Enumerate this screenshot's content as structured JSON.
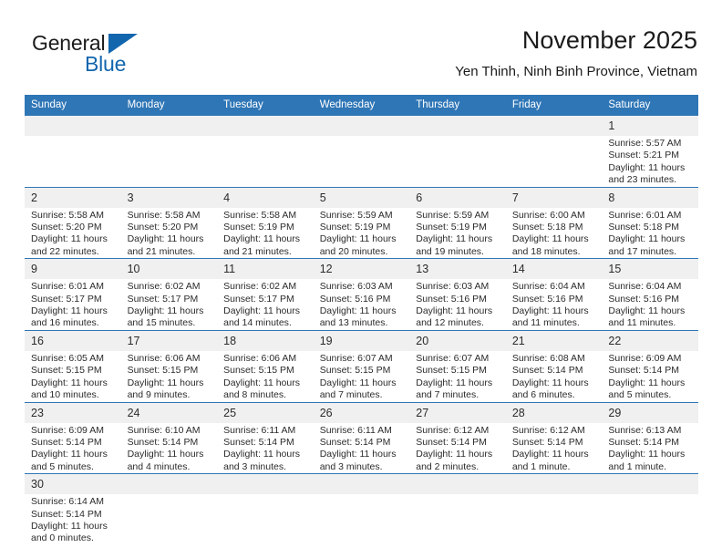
{
  "brand": {
    "name_part1": "General",
    "name_part2": "Blue",
    "accent_color": "#1266ae"
  },
  "header": {
    "title": "November 2025",
    "subtitle": "Yen Thinh, Ninh Binh Province, Vietnam"
  },
  "theme": {
    "header_blue": "#2f76b6",
    "daynum_band": "#f0f0f0",
    "text": "#2b2b2b"
  },
  "weekday_headers": [
    "Sunday",
    "Monday",
    "Tuesday",
    "Wednesday",
    "Thursday",
    "Friday",
    "Saturday"
  ],
  "weeks": [
    [
      {
        "day": "",
        "empty": true
      },
      {
        "day": "",
        "empty": true
      },
      {
        "day": "",
        "empty": true
      },
      {
        "day": "",
        "empty": true
      },
      {
        "day": "",
        "empty": true
      },
      {
        "day": "",
        "empty": true
      },
      {
        "day": "1",
        "sunrise": "Sunrise: 5:57 AM",
        "sunset": "Sunset: 5:21 PM",
        "daylight1": "Daylight: 11 hours",
        "daylight2": "and 23 minutes."
      }
    ],
    [
      {
        "day": "2",
        "sunrise": "Sunrise: 5:58 AM",
        "sunset": "Sunset: 5:20 PM",
        "daylight1": "Daylight: 11 hours",
        "daylight2": "and 22 minutes."
      },
      {
        "day": "3",
        "sunrise": "Sunrise: 5:58 AM",
        "sunset": "Sunset: 5:20 PM",
        "daylight1": "Daylight: 11 hours",
        "daylight2": "and 21 minutes."
      },
      {
        "day": "4",
        "sunrise": "Sunrise: 5:58 AM",
        "sunset": "Sunset: 5:19 PM",
        "daylight1": "Daylight: 11 hours",
        "daylight2": "and 21 minutes."
      },
      {
        "day": "5",
        "sunrise": "Sunrise: 5:59 AM",
        "sunset": "Sunset: 5:19 PM",
        "daylight1": "Daylight: 11 hours",
        "daylight2": "and 20 minutes."
      },
      {
        "day": "6",
        "sunrise": "Sunrise: 5:59 AM",
        "sunset": "Sunset: 5:19 PM",
        "daylight1": "Daylight: 11 hours",
        "daylight2": "and 19 minutes."
      },
      {
        "day": "7",
        "sunrise": "Sunrise: 6:00 AM",
        "sunset": "Sunset: 5:18 PM",
        "daylight1": "Daylight: 11 hours",
        "daylight2": "and 18 minutes."
      },
      {
        "day": "8",
        "sunrise": "Sunrise: 6:01 AM",
        "sunset": "Sunset: 5:18 PM",
        "daylight1": "Daylight: 11 hours",
        "daylight2": "and 17 minutes."
      }
    ],
    [
      {
        "day": "9",
        "sunrise": "Sunrise: 6:01 AM",
        "sunset": "Sunset: 5:17 PM",
        "daylight1": "Daylight: 11 hours",
        "daylight2": "and 16 minutes."
      },
      {
        "day": "10",
        "sunrise": "Sunrise: 6:02 AM",
        "sunset": "Sunset: 5:17 PM",
        "daylight1": "Daylight: 11 hours",
        "daylight2": "and 15 minutes."
      },
      {
        "day": "11",
        "sunrise": "Sunrise: 6:02 AM",
        "sunset": "Sunset: 5:17 PM",
        "daylight1": "Daylight: 11 hours",
        "daylight2": "and 14 minutes."
      },
      {
        "day": "12",
        "sunrise": "Sunrise: 6:03 AM",
        "sunset": "Sunset: 5:16 PM",
        "daylight1": "Daylight: 11 hours",
        "daylight2": "and 13 minutes."
      },
      {
        "day": "13",
        "sunrise": "Sunrise: 6:03 AM",
        "sunset": "Sunset: 5:16 PM",
        "daylight1": "Daylight: 11 hours",
        "daylight2": "and 12 minutes."
      },
      {
        "day": "14",
        "sunrise": "Sunrise: 6:04 AM",
        "sunset": "Sunset: 5:16 PM",
        "daylight1": "Daylight: 11 hours",
        "daylight2": "and 11 minutes."
      },
      {
        "day": "15",
        "sunrise": "Sunrise: 6:04 AM",
        "sunset": "Sunset: 5:16 PM",
        "daylight1": "Daylight: 11 hours",
        "daylight2": "and 11 minutes."
      }
    ],
    [
      {
        "day": "16",
        "sunrise": "Sunrise: 6:05 AM",
        "sunset": "Sunset: 5:15 PM",
        "daylight1": "Daylight: 11 hours",
        "daylight2": "and 10 minutes."
      },
      {
        "day": "17",
        "sunrise": "Sunrise: 6:06 AM",
        "sunset": "Sunset: 5:15 PM",
        "daylight1": "Daylight: 11 hours",
        "daylight2": "and 9 minutes."
      },
      {
        "day": "18",
        "sunrise": "Sunrise: 6:06 AM",
        "sunset": "Sunset: 5:15 PM",
        "daylight1": "Daylight: 11 hours",
        "daylight2": "and 8 minutes."
      },
      {
        "day": "19",
        "sunrise": "Sunrise: 6:07 AM",
        "sunset": "Sunset: 5:15 PM",
        "daylight1": "Daylight: 11 hours",
        "daylight2": "and 7 minutes."
      },
      {
        "day": "20",
        "sunrise": "Sunrise: 6:07 AM",
        "sunset": "Sunset: 5:15 PM",
        "daylight1": "Daylight: 11 hours",
        "daylight2": "and 7 minutes."
      },
      {
        "day": "21",
        "sunrise": "Sunrise: 6:08 AM",
        "sunset": "Sunset: 5:14 PM",
        "daylight1": "Daylight: 11 hours",
        "daylight2": "and 6 minutes."
      },
      {
        "day": "22",
        "sunrise": "Sunrise: 6:09 AM",
        "sunset": "Sunset: 5:14 PM",
        "daylight1": "Daylight: 11 hours",
        "daylight2": "and 5 minutes."
      }
    ],
    [
      {
        "day": "23",
        "sunrise": "Sunrise: 6:09 AM",
        "sunset": "Sunset: 5:14 PM",
        "daylight1": "Daylight: 11 hours",
        "daylight2": "and 5 minutes."
      },
      {
        "day": "24",
        "sunrise": "Sunrise: 6:10 AM",
        "sunset": "Sunset: 5:14 PM",
        "daylight1": "Daylight: 11 hours",
        "daylight2": "and 4 minutes."
      },
      {
        "day": "25",
        "sunrise": "Sunrise: 6:11 AM",
        "sunset": "Sunset: 5:14 PM",
        "daylight1": "Daylight: 11 hours",
        "daylight2": "and 3 minutes."
      },
      {
        "day": "26",
        "sunrise": "Sunrise: 6:11 AM",
        "sunset": "Sunset: 5:14 PM",
        "daylight1": "Daylight: 11 hours",
        "daylight2": "and 3 minutes."
      },
      {
        "day": "27",
        "sunrise": "Sunrise: 6:12 AM",
        "sunset": "Sunset: 5:14 PM",
        "daylight1": "Daylight: 11 hours",
        "daylight2": "and 2 minutes."
      },
      {
        "day": "28",
        "sunrise": "Sunrise: 6:12 AM",
        "sunset": "Sunset: 5:14 PM",
        "daylight1": "Daylight: 11 hours",
        "daylight2": "and 1 minute."
      },
      {
        "day": "29",
        "sunrise": "Sunrise: 6:13 AM",
        "sunset": "Sunset: 5:14 PM",
        "daylight1": "Daylight: 11 hours",
        "daylight2": "and 1 minute."
      }
    ],
    [
      {
        "day": "30",
        "sunrise": "Sunrise: 6:14 AM",
        "sunset": "Sunset: 5:14 PM",
        "daylight1": "Daylight: 11 hours",
        "daylight2": "and 0 minutes."
      },
      {
        "day": "",
        "empty": true
      },
      {
        "day": "",
        "empty": true
      },
      {
        "day": "",
        "empty": true
      },
      {
        "day": "",
        "empty": true
      },
      {
        "day": "",
        "empty": true
      },
      {
        "day": "",
        "empty": true
      }
    ]
  ]
}
